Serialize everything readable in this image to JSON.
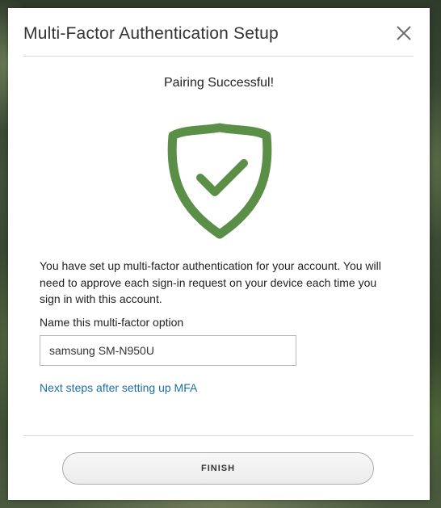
{
  "dialog": {
    "title": "Multi-Factor Authentication Setup",
    "close_icon": "close-icon"
  },
  "status": {
    "heading": "Pairing Successful!",
    "icon": "shield-check-icon",
    "icon_color": "#5b8f48"
  },
  "body": {
    "description": "You have set up multi-factor authentication for your account. You will need to approve each sign-in request on your device each time you sign in with this account."
  },
  "name_field": {
    "label": "Name this multi-factor option",
    "value": "samsung SM-N950U"
  },
  "links": {
    "next_steps": "Next steps after setting up MFA",
    "link_color": "#1d6fa5"
  },
  "footer": {
    "finish_label": "FINISH"
  }
}
